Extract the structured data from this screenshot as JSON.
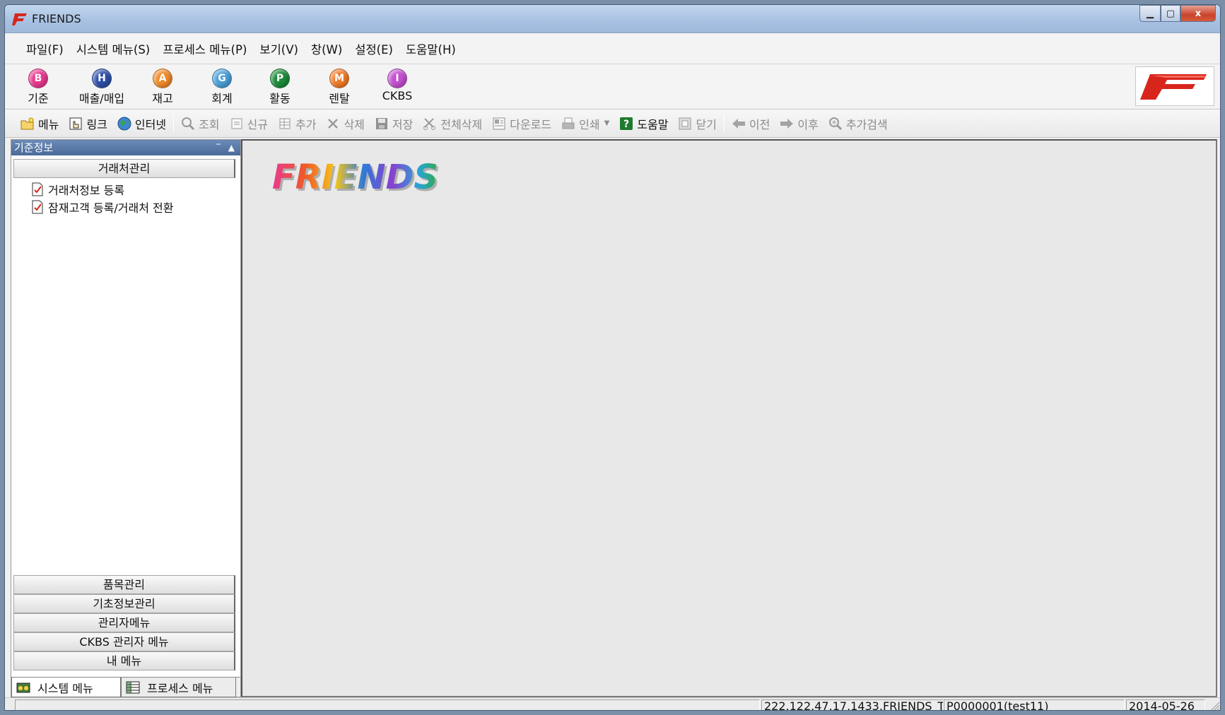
{
  "window": {
    "title": "FRIENDS",
    "minimize_label": "▁",
    "maximize_label": "▢",
    "close_label": "x"
  },
  "menubar": {
    "items": [
      "파일(F)",
      "시스템 메뉴(S)",
      "프로세스 메뉴(P)",
      "보기(V)",
      "창(W)",
      "설정(E)",
      "도움말(H)"
    ]
  },
  "modules": [
    {
      "letter": "B",
      "label": "기준",
      "color": "#e8398f"
    },
    {
      "letter": "H",
      "label": "매출/매입",
      "color": "#2e4fa8"
    },
    {
      "letter": "A",
      "label": "재고",
      "color": "#f08a2a"
    },
    {
      "letter": "G",
      "label": "회계",
      "color": "#4a9fd8"
    },
    {
      "letter": "P",
      "label": "활동",
      "color": "#1c8a3a"
    },
    {
      "letter": "M",
      "label": "렌탈",
      "color": "#f07a28"
    },
    {
      "letter": "I",
      "label": "CKBS",
      "color": "#c34fd0"
    }
  ],
  "toolbar": {
    "menu": "메뉴",
    "link": "링크",
    "internet": "인터넷",
    "search": "조회",
    "new": "신규",
    "add": "추가",
    "delete": "삭제",
    "save": "저장",
    "delete_all": "전체삭제",
    "download": "다운로드",
    "print": "인쇄",
    "help": "도움말",
    "close": "닫기",
    "prev": "이전",
    "next": "이후",
    "advanced_search": "추가검색"
  },
  "leftpanel": {
    "title": "기준정보",
    "group_active": "거래처관리",
    "tree_items": [
      "거래처정보 등록",
      "잠재고객 등록/거래처 전환"
    ],
    "groups": [
      "품목관리",
      "기초정보관리",
      "관리자메뉴",
      "CKBS 관리자 메뉴",
      "내 메뉴"
    ],
    "tabs": {
      "system": "시스템 메뉴",
      "process": "프로세스 메뉴"
    }
  },
  "main": {
    "logo_text": "FRIENDS"
  },
  "statusbar": {
    "server": "222.122.47.17,1433.FRIENDS_T",
    "user": "P0000001(test11)",
    "date": "2014-05-26"
  },
  "colors": {
    "brand_red": "#d8251b",
    "titlebar": "#a9c2e2",
    "panel_header": "#4b6b99"
  }
}
